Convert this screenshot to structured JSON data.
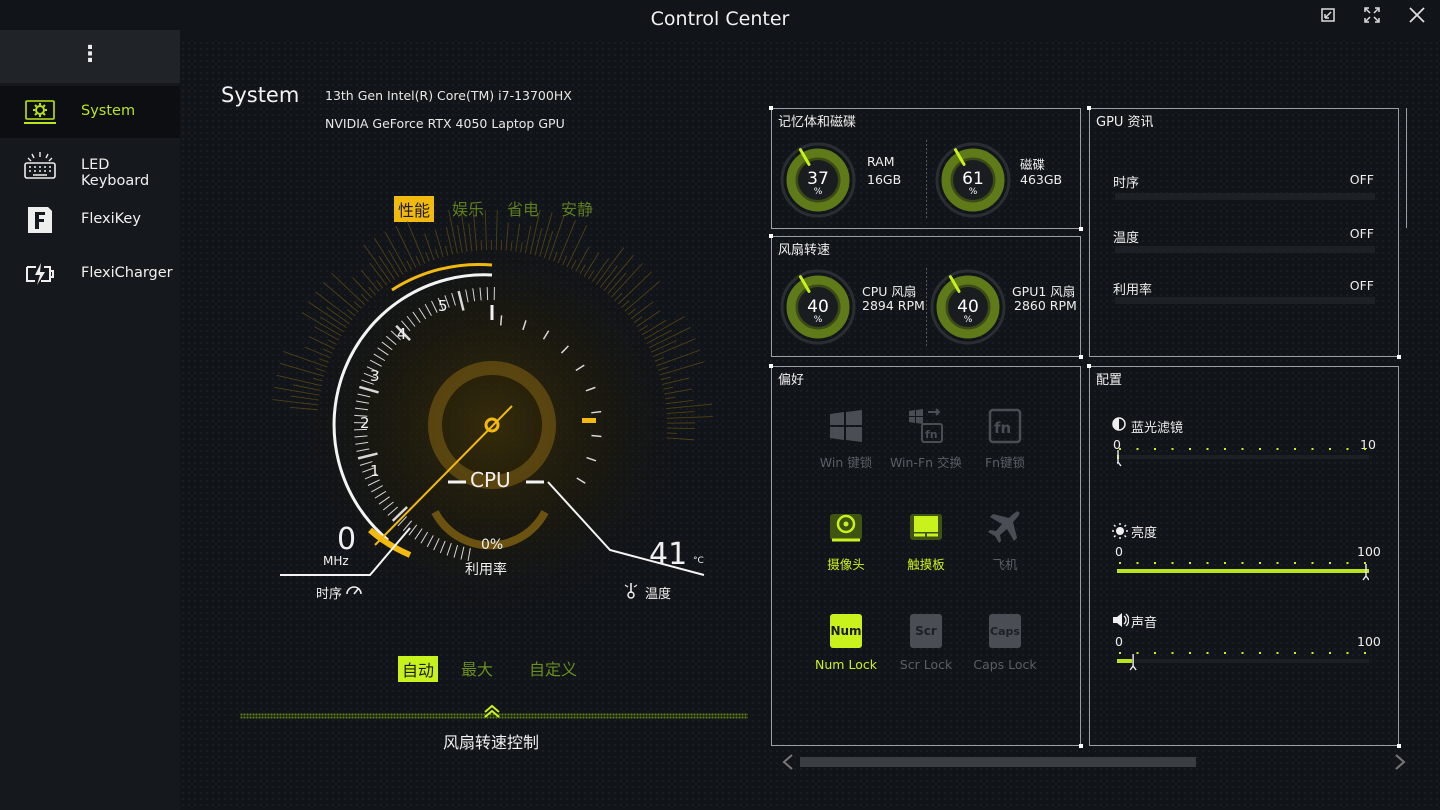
{
  "app_title": "Control Center",
  "titlebar": {
    "restore_icon": "restore-icon",
    "maximize_icon": "maximize-icon",
    "close_icon": "close-icon"
  },
  "sidebar": {
    "menu_glyph": "⋮",
    "items": [
      {
        "label": "System",
        "icon": "system-gear-icon",
        "active": true
      },
      {
        "label": "LED Keyboard",
        "icon": "keyboard-icon",
        "active": false
      },
      {
        "label": "FlexiKey",
        "icon": "flexikey-icon",
        "active": false
      },
      {
        "label": "FlexiCharger",
        "icon": "charger-icon",
        "active": false
      }
    ]
  },
  "system": {
    "title": "System",
    "cpu_name": "13th Gen Intel(R) Core(TM) i7-13700HX",
    "gpu_name": "NVIDIA GeForce RTX 4050 Laptop GPU"
  },
  "modes": {
    "items": [
      "性能",
      "娱乐",
      "省电",
      "安静"
    ],
    "active": "性能"
  },
  "gauge": {
    "ticks": [
      "1",
      "2",
      "3",
      "4",
      "5"
    ],
    "center_label": "CPU",
    "frequency": {
      "value": "0",
      "unit": "MHz",
      "label": "时序"
    },
    "usage": {
      "value": "0%",
      "label": "利用率"
    },
    "temperature": {
      "value": "41",
      "unit": "°C",
      "label": "温度"
    },
    "accent": "#f2b90f"
  },
  "fan_modes": {
    "items": [
      "自动",
      "最大",
      "自定义"
    ],
    "active": "自动",
    "control_label": "风扇转速控制"
  },
  "memory_panel": {
    "title": "记忆体和磁碟",
    "ram": {
      "percent": 37,
      "value": "37",
      "unit": "%",
      "label": "RAM",
      "detail": "16GB"
    },
    "disk": {
      "percent": 61,
      "value": "61",
      "unit": "%",
      "label": "磁碟",
      "detail": "463GB"
    }
  },
  "fan_panel": {
    "title": "风扇转速",
    "cpu_fan": {
      "percent": 40,
      "value": "40",
      "unit": "%",
      "label": "CPU 风扇",
      "detail": "2894 RPM"
    },
    "gpu_fan": {
      "percent": 40,
      "value": "40",
      "unit": "%",
      "label": "GPU1 风扇",
      "detail": "2860 RPM"
    }
  },
  "gpu_panel": {
    "title": "GPU 资讯",
    "rows": [
      {
        "label": "时序",
        "value": "OFF"
      },
      {
        "label": "温度",
        "value": "OFF"
      },
      {
        "label": "利用率",
        "value": "OFF"
      }
    ]
  },
  "pref_panel": {
    "title": "偏好",
    "buttons": [
      {
        "label": "Win 键锁",
        "icon": "windows-icon",
        "on": false
      },
      {
        "label": "Win-Fn 交换",
        "icon": "win-fn-swap-icon",
        "on": false
      },
      {
        "label": "Fn键锁",
        "icon": "fn-lock-icon",
        "on": false
      },
      {
        "label": "摄像头",
        "icon": "camera-icon",
        "on": true
      },
      {
        "label": "触摸板",
        "icon": "touchpad-icon",
        "on": true
      },
      {
        "label": "飞机",
        "icon": "airplane-icon",
        "on": false
      },
      {
        "label": "Num Lock",
        "icon": "num-lock-icon",
        "icon_text": "Num",
        "on": true
      },
      {
        "label": "Scr Lock",
        "icon": "scroll-lock-icon",
        "icon_text": "Scr",
        "on": false
      },
      {
        "label": "Caps Lock",
        "icon": "caps-lock-icon",
        "icon_text": "Caps",
        "on": false
      }
    ]
  },
  "config_panel": {
    "title": "配置",
    "sliders": [
      {
        "label": "蓝光滤镜",
        "icon": "blue-light-icon",
        "min": "0",
        "max": "10",
        "value": 0,
        "range": 10
      },
      {
        "label": "亮度",
        "icon": "brightness-icon",
        "min": "0",
        "max": "100",
        "value": 100,
        "range": 100
      },
      {
        "label": "声音",
        "icon": "volume-icon",
        "min": "0",
        "max": "100",
        "value": 6,
        "range": 100
      }
    ]
  },
  "colors": {
    "accent_green": "#c9f21c",
    "accent_yellow": "#f2b90f",
    "muted": "#5a5f66"
  }
}
